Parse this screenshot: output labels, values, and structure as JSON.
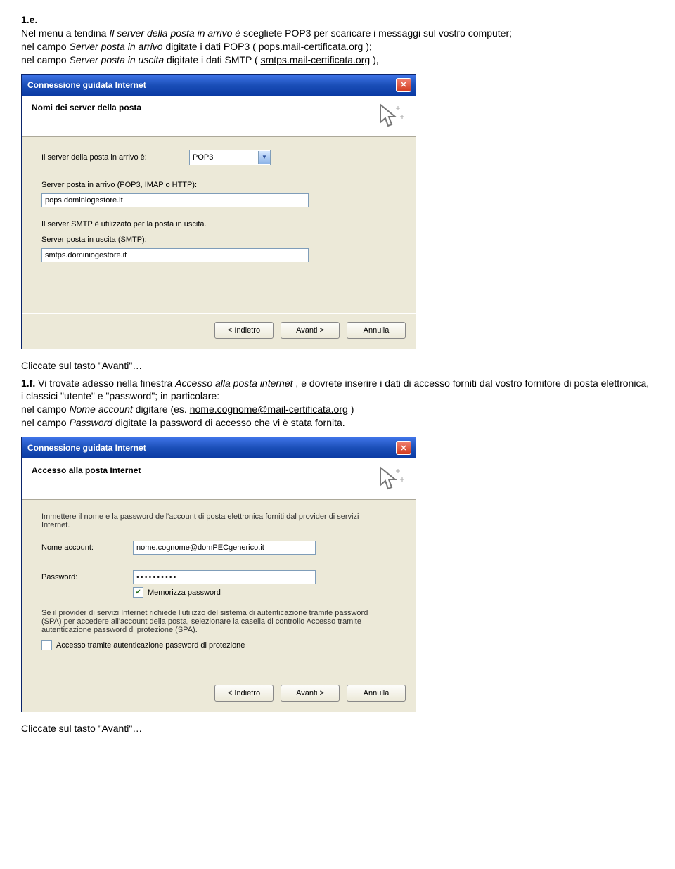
{
  "doc": {
    "sec1_num": "1.e.",
    "sec1_line1a": "Nel menu a tendina ",
    "sec1_line1b": "Il server della posta in arrivo è",
    "sec1_line1c": " scegliete POP3 per scaricare i messaggi sul vostro computer;",
    "sec1_line2a": "nel campo ",
    "sec1_line2b": "Server posta in arrivo",
    "sec1_line2c": " digitate i dati POP3  ( ",
    "sec1_line2d": "pops.mail-certificata.org",
    "sec1_line2e": ");",
    "sec1_line3a": "nel campo ",
    "sec1_line3b": "Server posta in uscita",
    "sec1_line3c": " digitate i dati SMTP (",
    "sec1_line3d": "smtps.mail-certificata.org",
    "sec1_line3e": "),",
    "mid_text": "Cliccate sul tasto \"Avanti\"…",
    "sec2_num": "1.f.",
    "sec2_line1a": " Vi trovate adesso nella finestra ",
    "sec2_line1b": "Accesso alla posta internet",
    "sec2_line1c": ", e dovrete inserire i dati di accesso forniti dal vostro fornitore di posta elettronica, i classici \"utente\" e \"password\"; in particolare:",
    "sec2_line2a": "nel campo ",
    "sec2_line2b": "Nome account",
    "sec2_line2c": " digitare (es. ",
    "sec2_line2d": "nome.cognome@mail-certificata.org",
    "sec2_line2e": ")",
    "sec2_line3a": "nel campo ",
    "sec2_line3b": "Password",
    "sec2_line3c": " digitate la password di accesso che vi è stata fornita.",
    "end_text": "Cliccate sul tasto \"Avanti\"…"
  },
  "dialog1": {
    "title": "Connessione guidata Internet",
    "banner": "Nomi dei server della posta",
    "label_type": "Il server della posta in arrivo è:",
    "select_value": "POP3",
    "label_incoming": "Server posta in arrivo (POP3, IMAP o HTTP):",
    "value_incoming": "pops.dominiogestore.it",
    "label_smtp_info": "Il server SMTP è utilizzato per la posta in uscita.",
    "label_outgoing": "Server posta in uscita (SMTP):",
    "value_outgoing": "smtps.dominiogestore.it",
    "btn_back": "< Indietro",
    "btn_next": "Avanti >",
    "btn_cancel": "Annulla"
  },
  "dialog2": {
    "title": "Connessione guidata Internet",
    "banner": "Accesso alla posta Internet",
    "intro": "Immettere il nome e la password dell'account di posta elettronica forniti dal provider di servizi Internet.",
    "label_account": "Nome account:",
    "value_account": "nome.cognome@domPECgenerico.it",
    "label_password": "Password:",
    "value_password": "••••••••••",
    "remember": "Memorizza password",
    "spa_text": "Se il provider di servizi Internet richiede l'utilizzo del sistema di autenticazione tramite password (SPA) per accedere all'account della posta, selezionare la casella di controllo Accesso tramite autenticazione password di protezione (SPA).",
    "spa_check": "Accesso tramite autenticazione password di protezione",
    "btn_back": "< Indietro",
    "btn_next": "Avanti >",
    "btn_cancel": "Annulla"
  }
}
